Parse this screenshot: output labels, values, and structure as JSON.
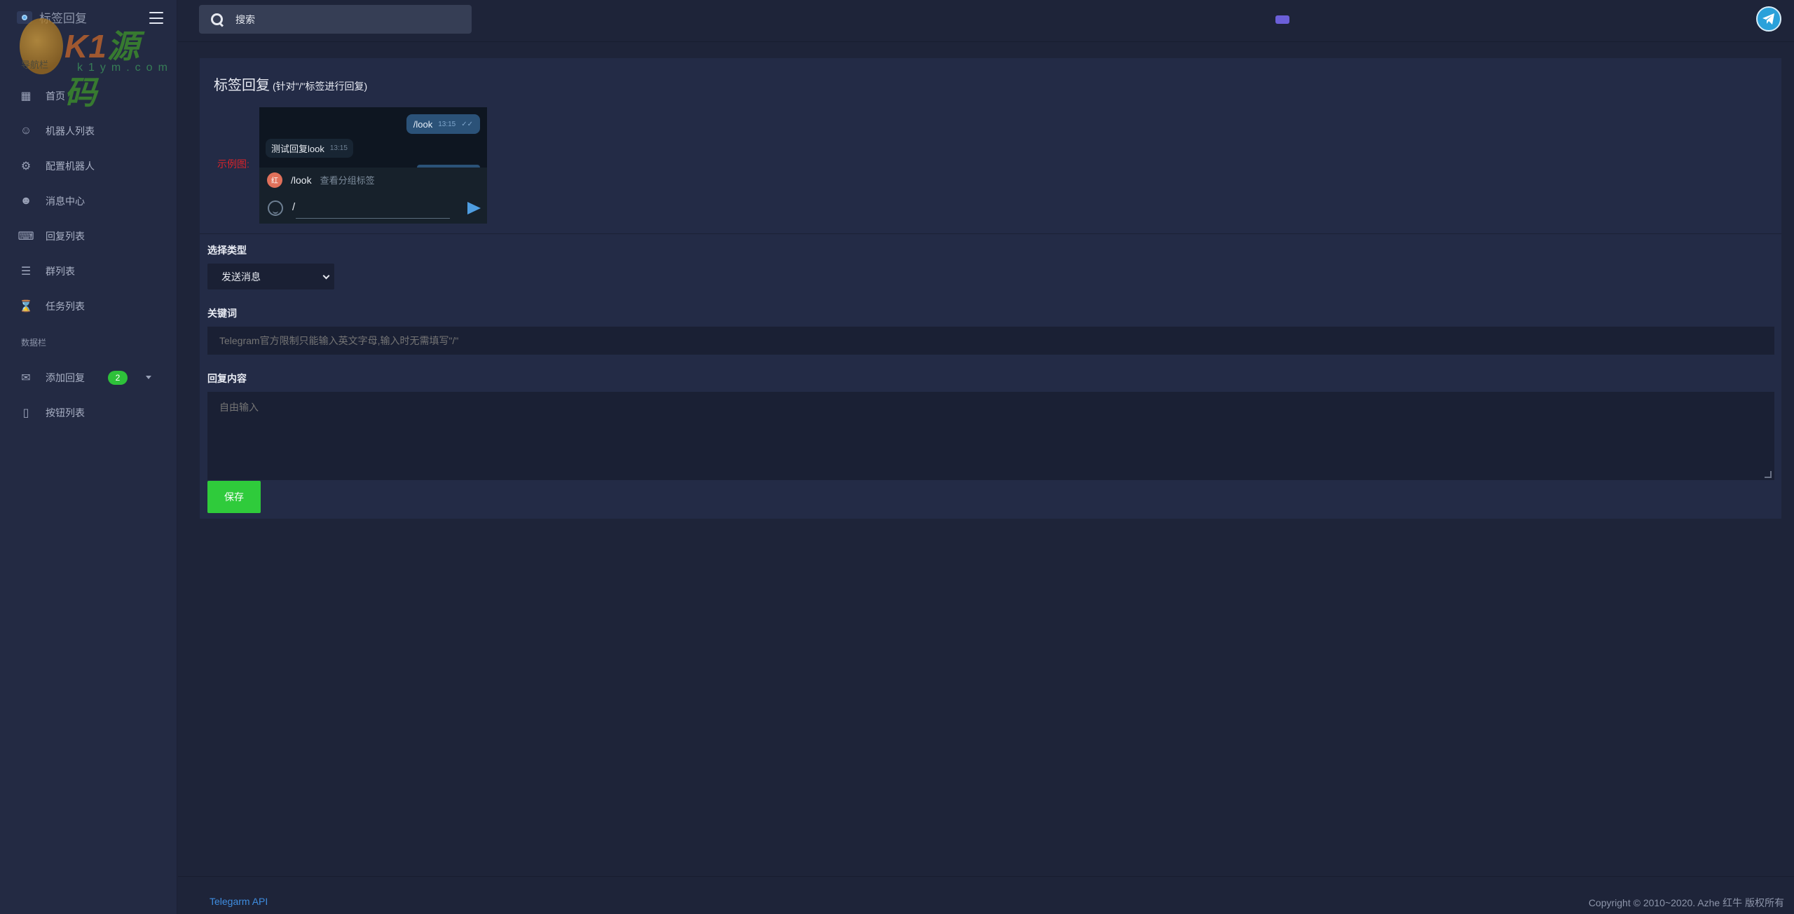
{
  "app": {
    "brand": "标签回复",
    "watermark": {
      "main": "K1",
      "accent": "源码",
      "sub": "k1ym.com",
      "tag": "导航栏"
    }
  },
  "colors": {
    "accent_green": "#2fcb3b",
    "link_blue": "#3f8de0",
    "example_red": "#d8232a",
    "sidebar_bg": "#232a43",
    "page_bg": "#1e2439",
    "card_bg": "#232b46"
  },
  "sidebar": {
    "items": [
      {
        "label": "首页",
        "icon": "robot-icon"
      },
      {
        "label": "机器人列表",
        "icon": "user-circle-icon"
      },
      {
        "label": "配置机器人",
        "icon": "gears-icon"
      },
      {
        "label": "消息中心",
        "icon": "smile-icon"
      },
      {
        "label": "回复列表",
        "icon": "keyboard-icon"
      },
      {
        "label": "群列表",
        "icon": "layers-icon"
      },
      {
        "label": "任务列表",
        "icon": "hourglass-icon"
      }
    ],
    "section_title": "数据栏",
    "data_items": [
      {
        "label": "添加回复",
        "icon": "comments-icon",
        "badge": "2"
      },
      {
        "label": "按钮列表",
        "icon": "sticky-note-icon"
      }
    ]
  },
  "topbar": {
    "search_placeholder": "搜索"
  },
  "card": {
    "title": "标签回复",
    "subtitle": "(针对\"/\"标签进行回复)",
    "example_label": "示例图:",
    "chat": {
      "out_text": "/look",
      "out_time": "13:15",
      "in_text": "测试回复look",
      "in_time": "13:15",
      "cmd_avatar": "红",
      "cmd_name": "/look",
      "cmd_desc": "查看分组标签",
      "input_text": "/"
    },
    "type_label": "选择类型",
    "type_value": "发送消息",
    "keyword_label": "关键词",
    "keyword_placeholder": "Telegram官方限制只能输入英文字母,输入时无需填写\"/\"",
    "reply_label": "回复内容",
    "reply_placeholder": "自由输入",
    "save_label": "保存"
  },
  "footer": {
    "link": "Telegarm API",
    "copyright": "Copyright © 2010~2020. Azhe 红牛 版权所有"
  }
}
